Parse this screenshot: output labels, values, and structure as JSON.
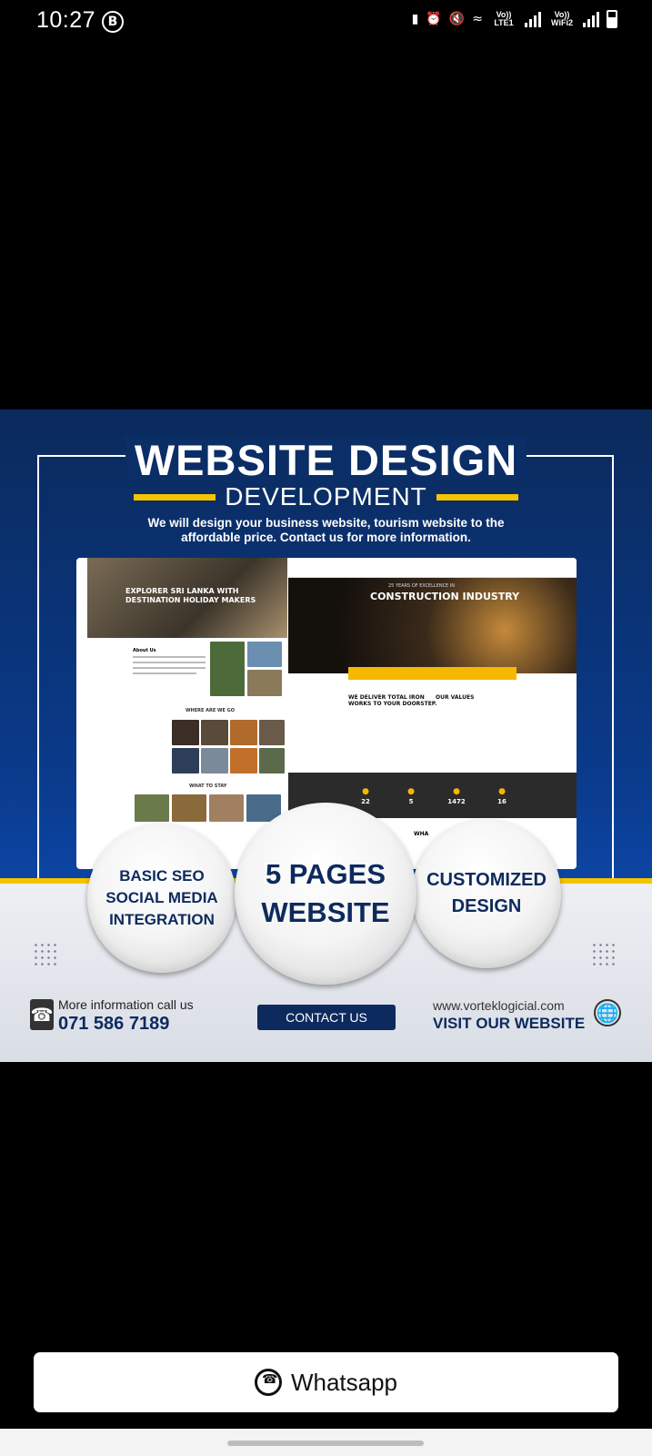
{
  "status_bar": {
    "time": "10:27",
    "b_badge": "B",
    "lte_label": "Vo)) LTE1",
    "wifi_label": "Vo)) WiFi2",
    "icons": [
      "battery-saver-icon",
      "alarm-icon",
      "mute-icon",
      "wifi-icon",
      "signal-icon",
      "signal-icon",
      "battery-icon"
    ]
  },
  "poster": {
    "title": "WEBSITE DESIGN",
    "subtitle": "DEVELOPMENT",
    "description_line1": "We will design your business website, tourism website to the",
    "description_line2": "affordable price. Contact us for more information.",
    "mock_left": {
      "hero_text_line1": "EXPLORER SRI LANKA WITH",
      "hero_text_line2": "DESTINATION HOLIDAY MAKERS",
      "about_heading": "About Us",
      "where_heading": "WHERE ARE WE GO",
      "stay_heading": "WHAT TO STAY"
    },
    "mock_right": {
      "hero_small": "25 YEARS OF EXCELLENCE IN",
      "hero_title": "CONSTRUCTION INDUSTRY",
      "deliver_line1": "WE DELIVER TOTAL IRON",
      "deliver_line2": "WORKS TO YOUR DOORSTEP.",
      "values_heading": "OUR VALUES",
      "stats": [
        {
          "value": "22",
          "label": "TOTAL PROJECTS"
        },
        {
          "value": "5",
          "label": "STAFF MEMBERS"
        },
        {
          "value": "1472",
          "label": "HOURS OF WORK"
        },
        {
          "value": "16",
          "label": "CUSTOMERS"
        }
      ],
      "bottom_text": "WHA"
    },
    "circles": {
      "left_line1": "BASIC SEO",
      "left_line2": "SOCIAL MEDIA",
      "left_line3": "INTEGRATION",
      "center_line1": "5 PAGES",
      "center_line2": "WEBSITE",
      "right_line1": "CUSTOMIZED",
      "right_line2": "DESIGN"
    },
    "footer": {
      "more_info": "More information call us",
      "phone": "071 586 7189",
      "contact_button": "CONTACT US",
      "url": "www.vorteklogicial.com",
      "visit": "VISIT OUR WEBSITE"
    },
    "colors": {
      "navy": "#0d2a5e",
      "yellow": "#f5c400",
      "blue": "#0a3a8a"
    }
  },
  "whatsapp_button": {
    "label": "Whatsapp",
    "icon": "whatsapp-icon"
  }
}
